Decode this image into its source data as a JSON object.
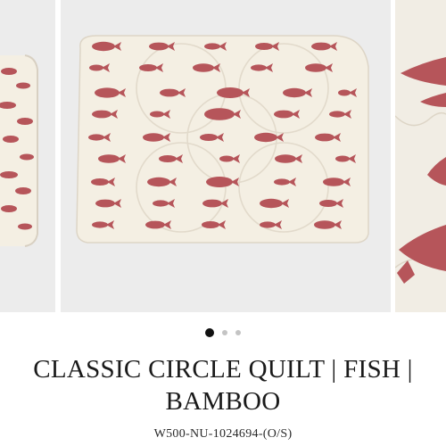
{
  "product": {
    "title": "CLASSIC CIRCLE QUILT | FISH | BAMBOO",
    "sku": "W500-NU-1024694-(O/S)"
  },
  "gallery": {
    "slide_count": 3,
    "active_index": 0,
    "zoom_icon": "search-icon",
    "fish_color": "#b6555a",
    "fabric_color": "#f4efe3"
  }
}
